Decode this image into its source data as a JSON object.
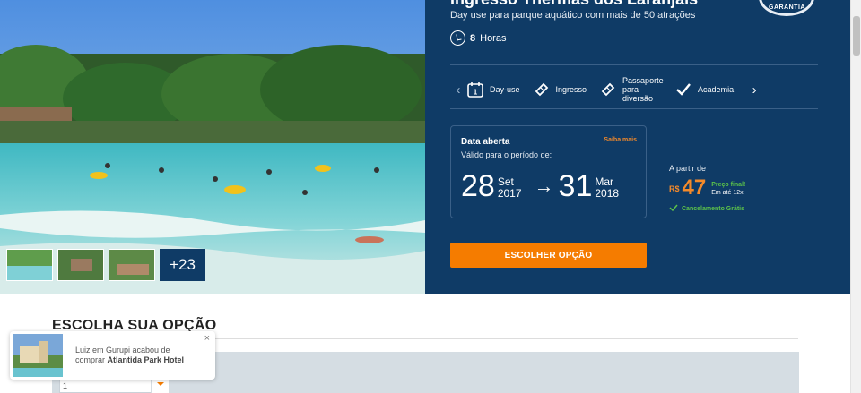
{
  "product": {
    "title": "Ingresso Thermas dos Laranjais",
    "subtitle": "Day use para parque aquático com mais de 50 atrações",
    "duration_value": "8",
    "duration_unit": "Horas",
    "seal_text": "GARANTIA"
  },
  "features": [
    {
      "label": "Day-use",
      "icon": "calendar-icon"
    },
    {
      "label": "Ingresso",
      "icon": "ticket-icon"
    },
    {
      "label": "Passaporte para diversão",
      "icon": "ticket-icon"
    },
    {
      "label": "Academia",
      "icon": "check-icon"
    }
  ],
  "dates": {
    "title": "Data aberta",
    "more_link": "Saiba mais",
    "valid_label": "Válido para o período de:",
    "from_day": "28",
    "from_month": "Set",
    "from_year": "2017",
    "to_day": "31",
    "to_month": "Mar",
    "to_year": "2018"
  },
  "price": {
    "from_label": "A partir de",
    "currency": "R$",
    "value": "47",
    "final_label": "Preço final!",
    "installments": "Em até 12x",
    "cancellation": "Cancelamento Grátis"
  },
  "cta_label": "ESCOLHER OPÇÃO",
  "gallery": {
    "more_count": "+23"
  },
  "section": {
    "title": "ESCOLHA SUA OPÇÃO"
  },
  "select": {
    "value": "1"
  },
  "toast": {
    "line1": "Luiz em Gurupi acabou de",
    "line2_prefix": "comprar",
    "hotel": "Atlantida Park Hotel",
    "close": "×"
  },
  "colors": {
    "panel": "#0f3b66",
    "accent": "#f57c00",
    "success": "#5cc24a"
  }
}
